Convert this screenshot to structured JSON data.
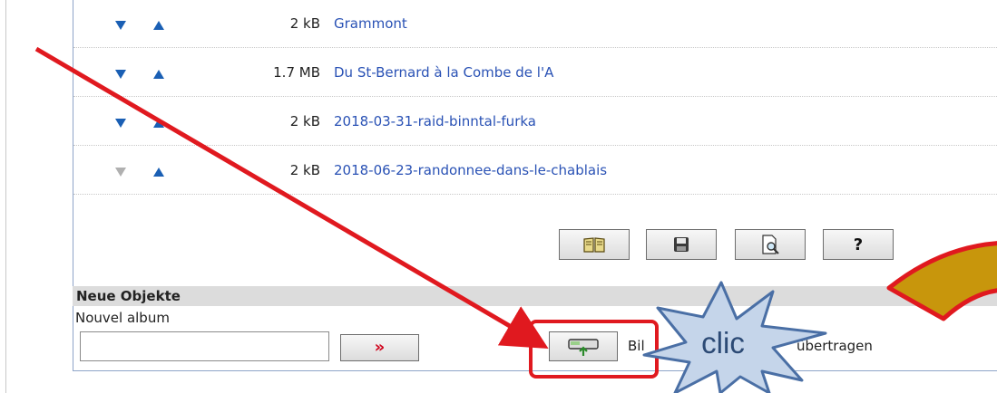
{
  "rows": [
    {
      "size": "2 kB",
      "name": "Grammont",
      "down_enabled": true
    },
    {
      "size": "1.7 MB",
      "name": "Du St-Bernard à la Combe de l'A",
      "down_enabled": true
    },
    {
      "size": "2 kB",
      "name": "2018-03-31-raid-binntal-furka",
      "down_enabled": true
    },
    {
      "size": "2 kB",
      "name": "2018-06-23-randonnee-dans-le-chablais",
      "down_enabled": false
    }
  ],
  "toolbar": {
    "buttons": [
      {
        "icon": "book-icon"
      },
      {
        "icon": "floppy-disk-icon"
      },
      {
        "icon": "preview-magnifier-icon"
      },
      {
        "icon": "help-icon",
        "label": "?"
      }
    ]
  },
  "new_objects": {
    "header": "Neue Objekte",
    "album_label": "Nouvel album",
    "album_value": "",
    "go_label": "»",
    "upload_text_start": "Bil",
    "upload_text_end": "übertragen"
  },
  "annotation": {
    "callout_text": "clic",
    "arrow_color": "#e0191f",
    "starburst_fill": "#c5d5ea",
    "starburst_stroke": "#4a6fa5",
    "highlight_color": "#e0191f",
    "shape_fill": "#c8960c"
  },
  "colors": {
    "link": "#2a52b5",
    "arrow_enabled": "#1a5fb4",
    "arrow_disabled": "#b0b0b0",
    "panel_border": "#8ea4c8",
    "section_header_bg": "#dcdcdc"
  }
}
